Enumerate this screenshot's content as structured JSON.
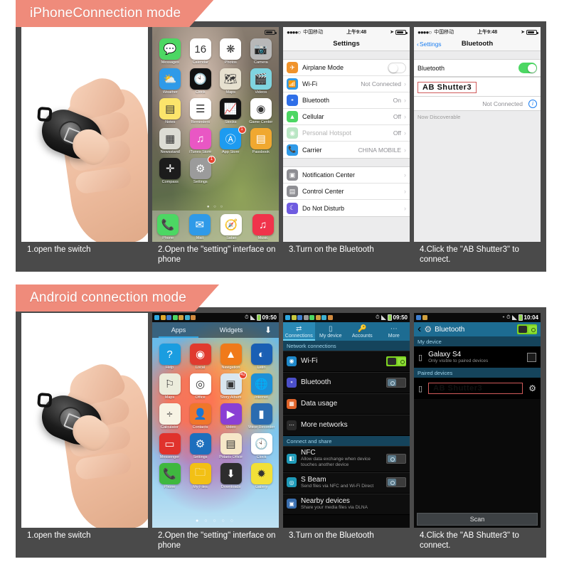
{
  "sections": [
    {
      "banner": "iPhoneConnection mode",
      "captions": [
        "1.open the switch",
        "2.Open the \"setting\" interface on phone",
        "3.Turn on the Bluetooth",
        "4.Click the \"AB Shutter3\" to connect."
      ]
    },
    {
      "banner": "Android connection mode",
      "captions": [
        "1.open the switch",
        "2.Open the \"setting\" interface on phone",
        "3.Turn on the Bluetooth",
        "4.Click the \"AB Shutter3\" to connect."
      ]
    }
  ],
  "ios": {
    "status": {
      "carrier": "中国移动",
      "time": "上午9:48",
      "dots": "●●●●○"
    },
    "home": {
      "apps": [
        {
          "label": "Messages",
          "glyph": "💬",
          "color": "#4cd763"
        },
        {
          "label": "Calendar",
          "glyph": "16",
          "color": "#ffffff"
        },
        {
          "label": "Photos",
          "glyph": "❋",
          "color": "#ffffff"
        },
        {
          "label": "Camera",
          "glyph": "📷",
          "color": "#b8b8b8"
        },
        {
          "label": "Weather",
          "glyph": "⛅",
          "color": "#2f9ae8"
        },
        {
          "label": "Clock",
          "glyph": "🕙",
          "color": "#111111"
        },
        {
          "label": "Maps",
          "glyph": "🗺",
          "color": "#e6e0cf"
        },
        {
          "label": "Videos",
          "glyph": "🎬",
          "color": "#7fd4e0"
        },
        {
          "label": "Notes",
          "glyph": "▤",
          "color": "#fbe46b"
        },
        {
          "label": "Reminders",
          "glyph": "☰",
          "color": "#ffffff"
        },
        {
          "label": "Stocks",
          "glyph": "📈",
          "color": "#121212"
        },
        {
          "label": "Game Center",
          "glyph": "◉",
          "color": "#ffffff"
        },
        {
          "label": "Newsstand",
          "glyph": "▦",
          "color": "#dcdcd4"
        },
        {
          "label": "iTunes Store",
          "glyph": "♫",
          "color": "#e957c4"
        },
        {
          "label": "App Store",
          "glyph": "Ⓐ",
          "color": "#1d9bf0",
          "badge": "1"
        },
        {
          "label": "Passbook",
          "glyph": "▤",
          "color": "#f0a830"
        },
        {
          "label": "Compass",
          "glyph": "✛",
          "color": "#1c1c1c"
        },
        {
          "label": "Settings",
          "glyph": "⚙",
          "color": "#9b9b9b",
          "badge": "1"
        }
      ],
      "dock": [
        {
          "label": "Phone",
          "glyph": "📞",
          "color": "#4cd763"
        },
        {
          "label": "Mail",
          "glyph": "✉",
          "color": "#2f9ae8"
        },
        {
          "label": "Safari",
          "glyph": "🧭",
          "color": "#ffffff"
        },
        {
          "label": "Music",
          "glyph": "♫",
          "color": "#f0334b"
        }
      ],
      "page_dots": "● ○ ○"
    },
    "settings": {
      "title": "Settings",
      "group1": [
        {
          "label": "Airplane Mode",
          "icon": "airplane-icon",
          "glyph": "✈",
          "color": "#f0932b",
          "control": "switch",
          "on": false
        },
        {
          "label": "Wi-Fi",
          "icon": "wifi-icon",
          "glyph": "📶",
          "color": "#2f9ae8",
          "value": "Not Connected"
        },
        {
          "label": "Bluetooth",
          "icon": "bluetooth-icon",
          "glyph": "᛭",
          "color": "#2f6fe8",
          "value": "On"
        },
        {
          "label": "Cellular",
          "icon": "cellular-icon",
          "glyph": "▲",
          "color": "#4cd763",
          "value": "Off"
        },
        {
          "label": "Personal Hotspot",
          "icon": "hotspot-icon",
          "glyph": "◉",
          "color": "#b9e6c4",
          "value": "Off",
          "dim": true
        },
        {
          "label": "Carrier",
          "icon": "carrier-icon",
          "glyph": "📞",
          "color": "#2f9ae8",
          "value": "CHINA MOBILE"
        }
      ],
      "group2": [
        {
          "label": "Notification Center",
          "icon": "notification-icon",
          "glyph": "▣",
          "color": "#8e8e93"
        },
        {
          "label": "Control Center",
          "icon": "control-icon",
          "glyph": "▤",
          "color": "#8e8e93"
        },
        {
          "label": "Do Not Disturb",
          "icon": "moon-icon",
          "glyph": "☾",
          "color": "#6f5ce0"
        }
      ]
    },
    "bluetooth": {
      "back": "Settings",
      "title": "Bluetooth",
      "toggle_label": "Bluetooth",
      "toggle_on": true,
      "device": "AB Shutter3",
      "device_status": "Not Connected",
      "note": "Now Discoverable"
    }
  },
  "android": {
    "status": {
      "time1": "09:50",
      "time2": "10:04"
    },
    "drawer": {
      "tabs": [
        "Apps",
        "Widgets"
      ],
      "active_tab": "Apps",
      "apps": [
        {
          "label": "Help",
          "glyph": "?",
          "color": "#1a9de0"
        },
        {
          "label": "Local",
          "glyph": "◉",
          "color": "#e03b2f"
        },
        {
          "label": "Navigation",
          "glyph": "▲",
          "color": "#f07a1a"
        },
        {
          "label": "Latin",
          "glyph": "◐",
          "color": "#1a5fb4"
        },
        {
          "label": "Maps",
          "glyph": "⚐",
          "color": "#ececdc"
        },
        {
          "label": "Office",
          "glyph": "◎",
          "color": "#ffffff"
        },
        {
          "label": "Story Album",
          "glyph": "▣",
          "color": "#d9e6ef",
          "badge": "42"
        },
        {
          "label": "Internet",
          "glyph": "🌐",
          "color": "#1e90d6"
        },
        {
          "label": "Calculator",
          "glyph": "÷",
          "color": "#f7f3e4"
        },
        {
          "label": "Contacts",
          "glyph": "👤",
          "color": "#f0762a"
        },
        {
          "label": "Video",
          "glyph": "▶",
          "color": "#8a3fd4"
        },
        {
          "label": "Voice Recorder",
          "glyph": "▮",
          "color": "#2b6cb0"
        },
        {
          "label": "Messenger",
          "glyph": "▭",
          "color": "#e0322c"
        },
        {
          "label": "Settings",
          "glyph": "⚙",
          "color": "#1d6fbd"
        },
        {
          "label": "Polaris Office",
          "glyph": "▤",
          "color": "#f6e7c8"
        },
        {
          "label": "Clock",
          "glyph": "🕙",
          "color": "#ffffff"
        },
        {
          "label": "Phone",
          "glyph": "📞",
          "color": "#3fb83f"
        },
        {
          "label": "My Files",
          "glyph": "🗀",
          "color": "#f2c015"
        },
        {
          "label": "Downloads",
          "glyph": "⬇",
          "color": "#2d2d2d"
        },
        {
          "label": "Gallery",
          "glyph": "✹",
          "color": "#f2e037"
        }
      ],
      "page_dots": "● ○ ○ ○ ○"
    },
    "settings": {
      "tabs": [
        {
          "label": "Connections",
          "glyph": "⇄",
          "active": true
        },
        {
          "label": "My device",
          "glyph": "▯",
          "active": false
        },
        {
          "label": "Accounts",
          "glyph": "🔑",
          "active": false
        },
        {
          "label": "More",
          "glyph": "⋯",
          "active": false
        }
      ],
      "section1": "Network connections",
      "rows1": [
        {
          "label": "Wi-Fi",
          "glyph": "◉",
          "color": "#1e88c9",
          "switch": "on"
        },
        {
          "label": "Bluetooth",
          "glyph": "᛭",
          "color": "#4b4fc9",
          "switch": "off"
        },
        {
          "label": "Data usage",
          "glyph": "▦",
          "color": "#e0642a",
          "switch": "none"
        },
        {
          "label": "More networks",
          "glyph": "⋯",
          "color": "#2a2a2a",
          "switch": "none"
        }
      ],
      "section2": "Connect and share",
      "rows2": [
        {
          "label": "NFC",
          "sub": "Allow data exchange when device touches another device",
          "glyph": "◧",
          "color": "#1f9ab8",
          "switch": "off"
        },
        {
          "label": "S Beam",
          "sub": "Send files via NFC and Wi-Fi Direct",
          "glyph": "◎",
          "color": "#1f9ab8",
          "switch": "off"
        },
        {
          "label": "Nearby devices",
          "sub": "Share your media files via DLNA",
          "glyph": "▣",
          "color": "#3a6fb0",
          "switch": "none"
        }
      ]
    },
    "bluetooth": {
      "title": "Bluetooth",
      "toggle_on": true,
      "section_my_device": "My device",
      "my_device_name": "Galaxy S4",
      "my_device_sub": "Only visible to paired devices",
      "section_paired": "Paired devices",
      "paired_device": "AB Shutter3",
      "scan_label": "Scan"
    }
  },
  "colors": {
    "banner": "#ef8b7b",
    "frame": "#4a4a4a",
    "highlight_box": "#d05a5a",
    "ios_blue": "#1a7df0",
    "ios_green": "#4cd763",
    "android_blue": "#1d6c92"
  }
}
